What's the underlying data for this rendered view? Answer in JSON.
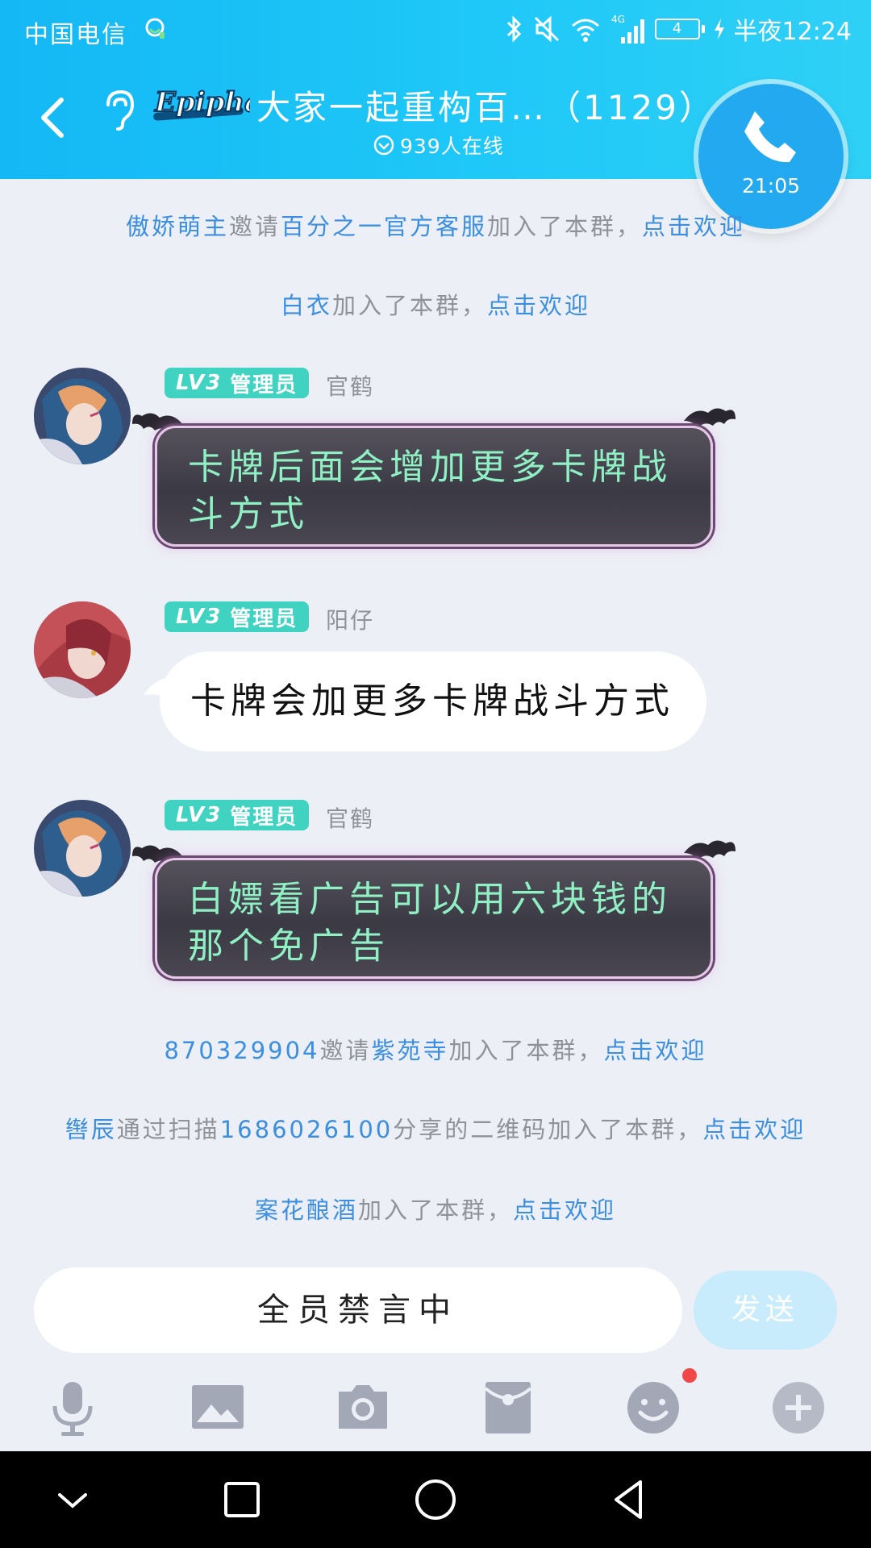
{
  "status_bar": {
    "carrier": "中国电信",
    "network": "4G",
    "battery_level": "4",
    "time": "半夜12:24"
  },
  "header": {
    "group_logo_text": "Epiphany",
    "group_title": "大家一起重构百…（1129）",
    "online_text": "939人在线",
    "call_time": "21:05"
  },
  "system_messages": [
    {
      "parts": [
        {
          "text": "傲娇萌主",
          "link": true
        },
        {
          "text": "邀请",
          "link": false
        },
        {
          "text": "百分之一官方客服",
          "link": true
        },
        {
          "text": "加入了本群，",
          "link": false
        },
        {
          "text": "点击欢迎",
          "link": true
        }
      ]
    },
    {
      "parts": [
        {
          "text": "白衣",
          "link": true
        },
        {
          "text": "加入了本群，",
          "link": false
        },
        {
          "text": "点击欢迎",
          "link": true
        }
      ]
    },
    {
      "parts": [
        {
          "text": "870329904",
          "link": true
        },
        {
          "text": "邀请",
          "link": false
        },
        {
          "text": "紫苑寺",
          "link": true
        },
        {
          "text": "加入了本群，",
          "link": false
        },
        {
          "text": "点击欢迎",
          "link": true
        }
      ]
    },
    {
      "parts": [
        {
          "text": "辔辰",
          "link": true
        },
        {
          "text": "通过扫描",
          "link": false
        },
        {
          "text": "1686026100",
          "link": true
        },
        {
          "text": "分享的二维码加入了本群，",
          "link": false
        },
        {
          "text": "点击欢迎",
          "link": true
        }
      ]
    },
    {
      "parts": [
        {
          "text": "案花酿酒",
          "link": true
        },
        {
          "text": "加入了本群，",
          "link": false
        },
        {
          "text": "点击欢迎",
          "link": true
        }
      ]
    }
  ],
  "messages": [
    {
      "level": "LV3",
      "role": "管理员",
      "sender": "官鹤",
      "text": "卡牌后面会增加更多卡牌战斗方式",
      "style": "dark"
    },
    {
      "level": "LV3",
      "role": "管理员",
      "sender": "阳仔",
      "text": "卡牌会加更多卡牌战斗方式",
      "style": "white"
    },
    {
      "level": "LV3",
      "role": "管理员",
      "sender": "官鹤",
      "text": "白嫖看广告可以用六块钱的那个免广告",
      "style": "dark"
    }
  ],
  "input": {
    "placeholder": "全员禁言中",
    "send_label": "发送"
  },
  "toolbar_icons": [
    "microphone-icon",
    "image-icon",
    "camera-icon",
    "red-packet-icon",
    "emoji-icon",
    "plus-icon"
  ],
  "colors": {
    "header": "#1ec8f7",
    "link": "#3b8ee0",
    "badge": "#40d3c1",
    "dark_bubble_text": "#8ff0c3"
  }
}
